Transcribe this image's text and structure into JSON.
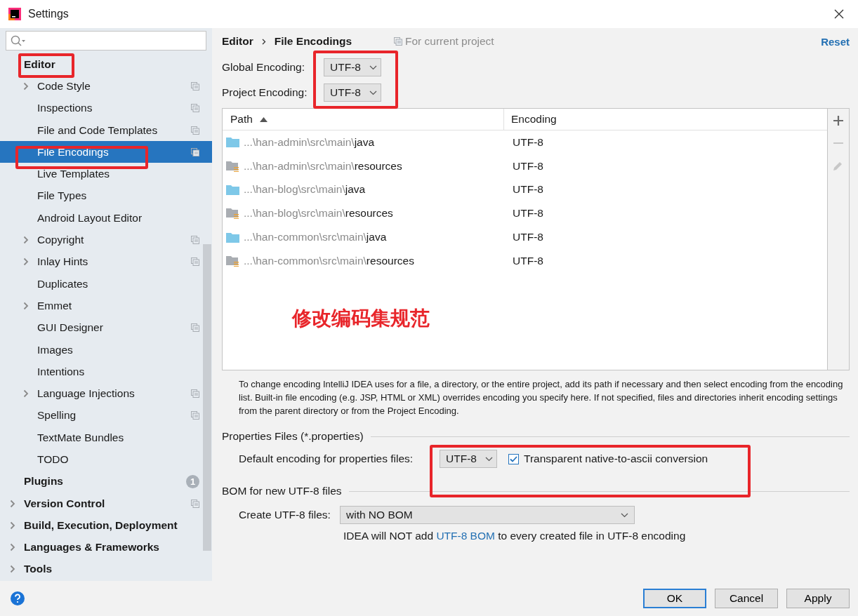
{
  "window": {
    "title": "Settings"
  },
  "sidebar": {
    "items": [
      {
        "label": "Editor",
        "expandable": false,
        "selected": false,
        "project_scoped": false,
        "children": [
          {
            "label": "Code Style",
            "expandable": true,
            "selected": false,
            "project_scoped": true
          },
          {
            "label": "Inspections",
            "expandable": false,
            "selected": false,
            "project_scoped": true
          },
          {
            "label": "File and Code Templates",
            "expandable": false,
            "selected": false,
            "project_scoped": true
          },
          {
            "label": "File Encodings",
            "expandable": false,
            "selected": true,
            "project_scoped": true
          },
          {
            "label": "Live Templates",
            "expandable": false,
            "selected": false,
            "project_scoped": false
          },
          {
            "label": "File Types",
            "expandable": false,
            "selected": false,
            "project_scoped": false
          },
          {
            "label": "Android Layout Editor",
            "expandable": false,
            "selected": false,
            "project_scoped": false
          },
          {
            "label": "Copyright",
            "expandable": true,
            "selected": false,
            "project_scoped": true
          },
          {
            "label": "Inlay Hints",
            "expandable": true,
            "selected": false,
            "project_scoped": true
          },
          {
            "label": "Duplicates",
            "expandable": false,
            "selected": false,
            "project_scoped": false
          },
          {
            "label": "Emmet",
            "expandable": true,
            "selected": false,
            "project_scoped": false
          },
          {
            "label": "GUI Designer",
            "expandable": false,
            "selected": false,
            "project_scoped": true
          },
          {
            "label": "Images",
            "expandable": false,
            "selected": false,
            "project_scoped": false
          },
          {
            "label": "Intentions",
            "expandable": false,
            "selected": false,
            "project_scoped": false
          },
          {
            "label": "Language Injections",
            "expandable": true,
            "selected": false,
            "project_scoped": true
          },
          {
            "label": "Spelling",
            "expandable": false,
            "selected": false,
            "project_scoped": true
          },
          {
            "label": "TextMate Bundles",
            "expandable": false,
            "selected": false,
            "project_scoped": false
          },
          {
            "label": "TODO",
            "expandable": false,
            "selected": false,
            "project_scoped": false
          }
        ]
      },
      {
        "label": "Plugins",
        "expandable": false,
        "selected": false,
        "project_scoped": false,
        "badge": "1"
      },
      {
        "label": "Version Control",
        "expandable": true,
        "selected": false,
        "project_scoped": true
      },
      {
        "label": "Build, Execution, Deployment",
        "expandable": true,
        "selected": false,
        "project_scoped": false
      },
      {
        "label": "Languages & Frameworks",
        "expandable": true,
        "selected": false,
        "project_scoped": false
      },
      {
        "label": "Tools",
        "expandable": true,
        "selected": false,
        "project_scoped": false
      }
    ]
  },
  "breadcrumb": [
    "Editor",
    "File Encodings"
  ],
  "scope_note": "For current project",
  "reset": "Reset",
  "global_encoding": {
    "label": "Global Encoding:",
    "value": "UTF-8"
  },
  "project_encoding": {
    "label": "Project Encoding:",
    "value": "UTF-8"
  },
  "table": {
    "columns": [
      "Path",
      "Encoding"
    ],
    "rows": [
      {
        "kind": "source",
        "prefix": "...\\han-admin\\src\\main\\",
        "name": "java",
        "encoding": "UTF-8"
      },
      {
        "kind": "resources",
        "prefix": "...\\han-admin\\src\\main\\",
        "name": "resources",
        "encoding": "UTF-8"
      },
      {
        "kind": "source",
        "prefix": "...\\han-blog\\src\\main\\",
        "name": "java",
        "encoding": "UTF-8"
      },
      {
        "kind": "resources",
        "prefix": "...\\han-blog\\src\\main\\",
        "name": "resources",
        "encoding": "UTF-8"
      },
      {
        "kind": "source",
        "prefix": "...\\han-common\\src\\main\\",
        "name": "java",
        "encoding": "UTF-8"
      },
      {
        "kind": "resources",
        "prefix": "...\\han-common\\src\\main\\",
        "name": "resources",
        "encoding": "UTF-8"
      }
    ],
    "tools": [
      {
        "kind": "add",
        "disabled": false
      },
      {
        "kind": "remove",
        "disabled": true
      },
      {
        "kind": "edit",
        "disabled": true
      }
    ]
  },
  "annotation": "修改编码集规范",
  "help_text": "To change encoding IntelliJ IDEA uses for a file, a directory, or the entire project, add its path if necessary and then select encoding from the encoding list. Built-in file encoding (e.g. JSP, HTML or XML) overrides encoding you specify here. If not specified, files and directories inherit encoding settings from the parent directory or from the Project Encoding.",
  "properties": {
    "title": "Properties Files (*.properties)",
    "label": "Default encoding for properties files:",
    "value": "UTF-8",
    "conversion": {
      "label": "Transparent native-to-ascii conversion",
      "checked": true
    }
  },
  "bom": {
    "title": "BOM for new UTF-8 files",
    "label": "Create UTF-8 files:",
    "value": "with NO BOM",
    "note_before": "IDEA will NOT add ",
    "note_link": "UTF-8 BOM",
    "note_after": " to every created file in UTF-8 encoding"
  },
  "buttons": [
    {
      "label": "OK",
      "kind": "default"
    },
    {
      "label": "Cancel",
      "kind": "normal"
    },
    {
      "label": "Apply",
      "kind": "normal"
    }
  ]
}
